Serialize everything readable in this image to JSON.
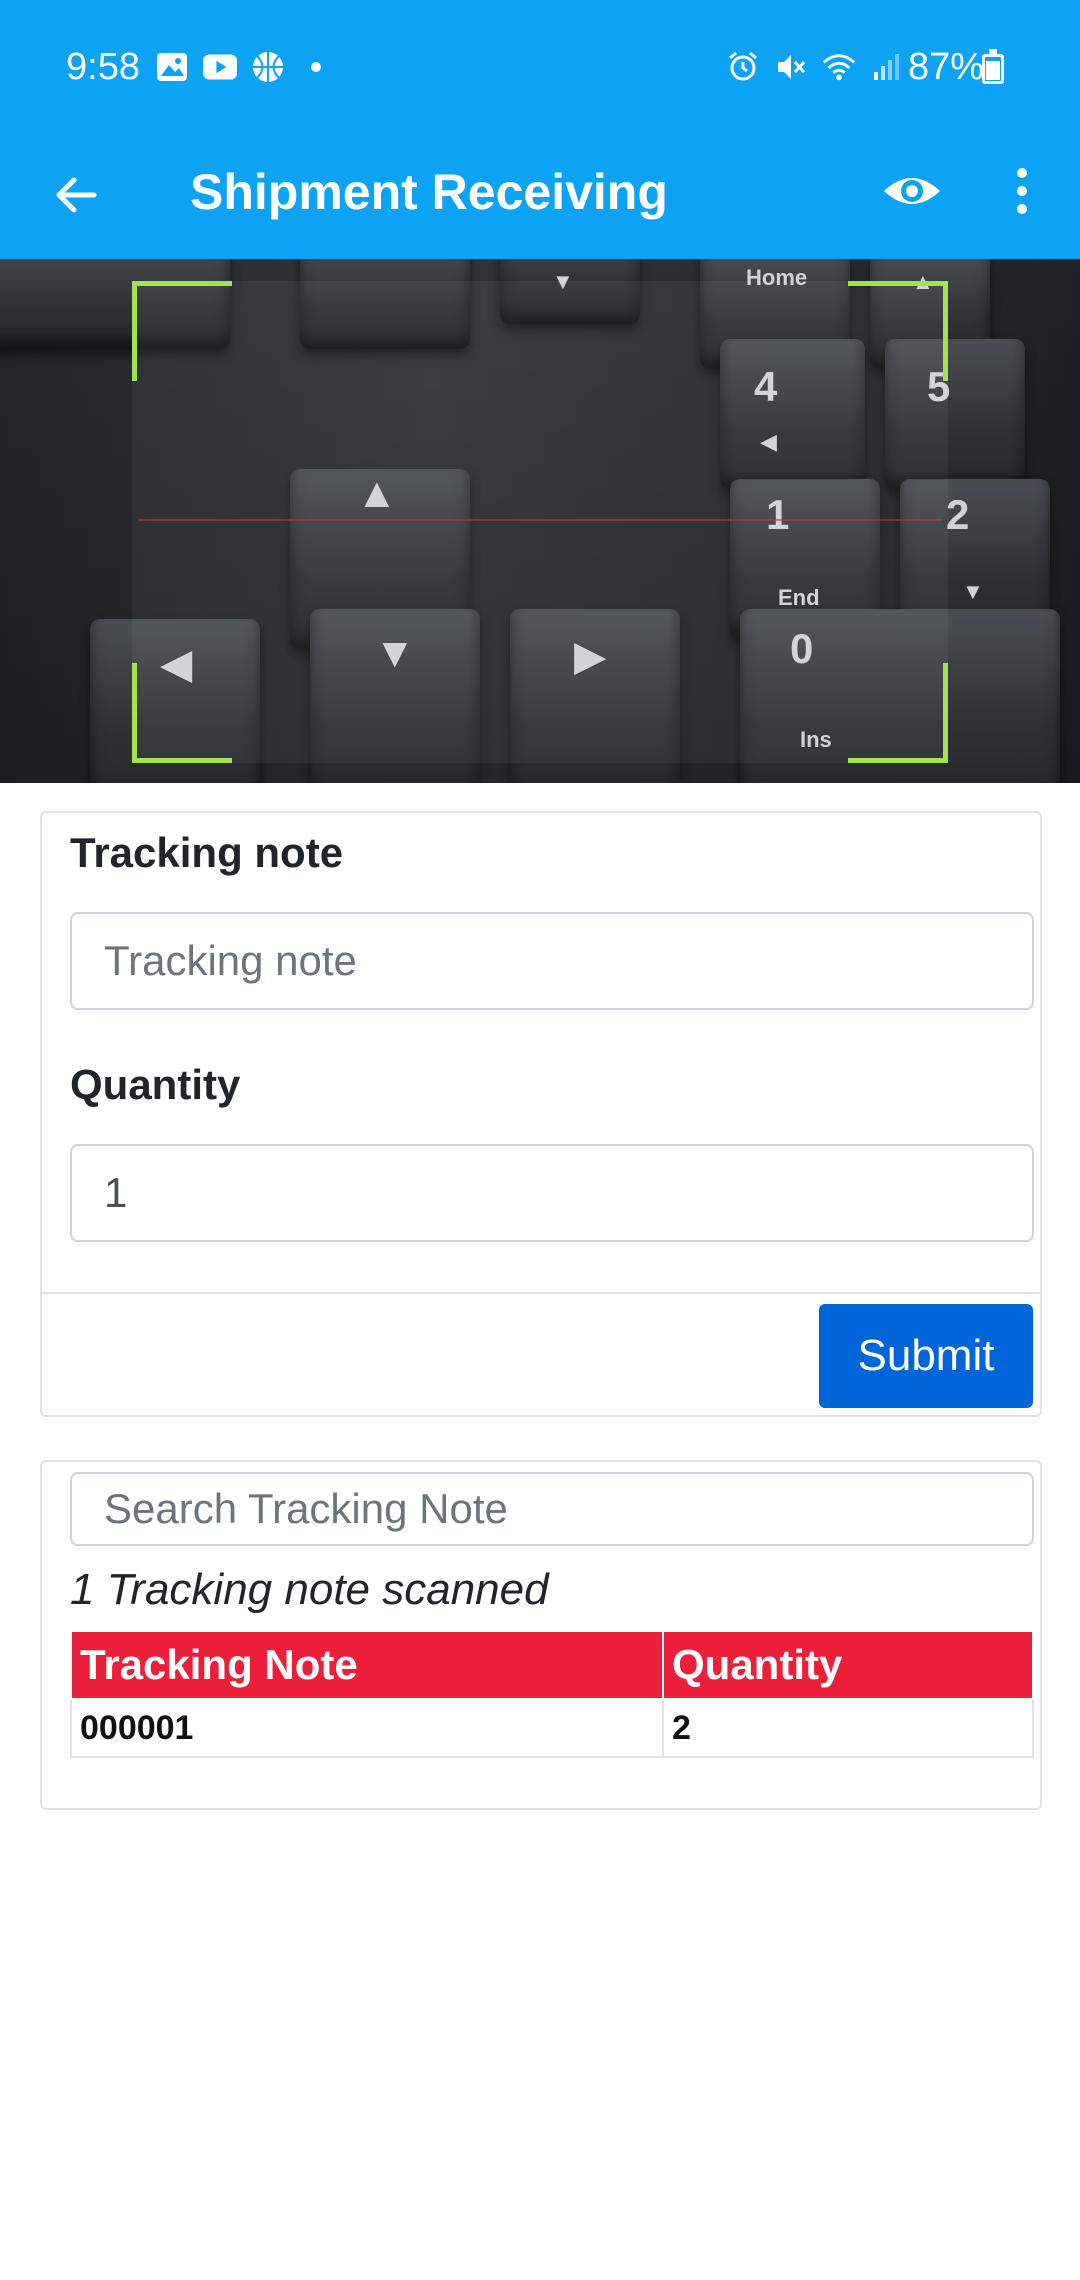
{
  "status_bar": {
    "time": "9:58",
    "battery": "87%",
    "battery_level": 0.87,
    "left_icons": [
      "image-icon",
      "youtube-icon",
      "basketball-icon",
      "dot-icon"
    ],
    "right_icons": [
      "alarm-icon",
      "mute-icon",
      "wifi-icon",
      "signal-icon"
    ]
  },
  "app_bar": {
    "title": "Shipment Receiving",
    "back_icon": "arrow-left-icon",
    "action_icons": [
      "eye-icon",
      "more-vert-icon"
    ],
    "color": "#0ca3f5"
  },
  "scanner": {
    "corner_color": "#a5e34c",
    "keys": {
      "home": "Home",
      "four": "4",
      "five": "5",
      "one": "1",
      "end": "End",
      "two": "2",
      "zero": "0",
      "ins": "Ins",
      "up": "▲",
      "left": "◀",
      "down": "▼",
      "right": "▶"
    }
  },
  "form": {
    "tracking_label": "Tracking note",
    "tracking_placeholder": "Tracking note",
    "tracking_value": "",
    "quantity_label": "Quantity",
    "quantity_value": "1",
    "submit_label": "Submit",
    "submit_color": "#0065d9"
  },
  "list": {
    "search_placeholder": "Search Tracking Note",
    "count_text": "1 Tracking note scanned",
    "header_color": "#ec1f3a",
    "columns": [
      "Tracking Note",
      "Quantity"
    ],
    "rows": [
      [
        "000001",
        "2"
      ]
    ]
  }
}
